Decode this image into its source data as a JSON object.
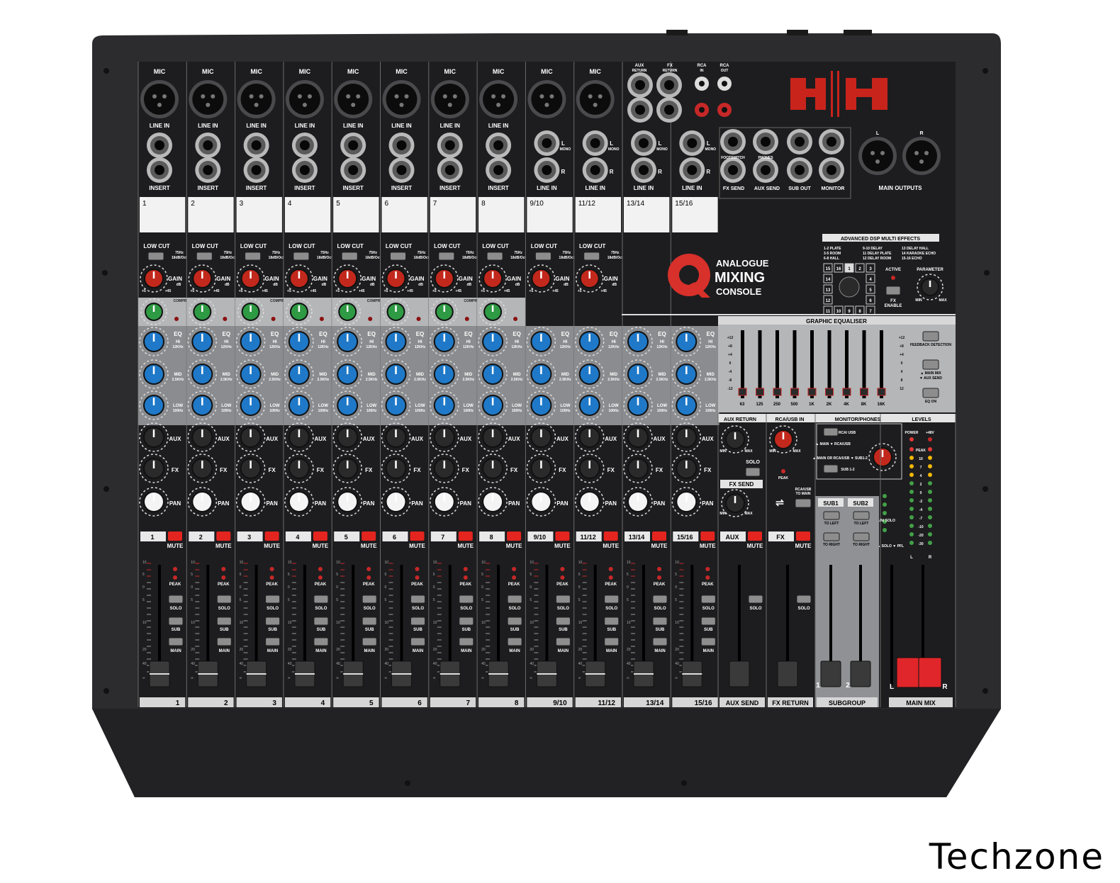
{
  "brand": {
    "logo": "H|H",
    "model_line1": "ANALOGUE",
    "model_line2": "MIXING",
    "model_line3": "CONSOLE"
  },
  "watermark": "Techzone",
  "colors": {
    "chassis": "#2c2c2e",
    "panel_dark": "#1d1d1f",
    "panel_grey": "#b4b6b8",
    "eq_band": "#8a8c8f",
    "label_white": "#f2f2f2",
    "mute_red": "#e4251f",
    "eq_knob": "#1f79c8",
    "comp_knob": "#2e9a43",
    "gain_knob": "#c2281c",
    "main_fader": "#e0262a"
  },
  "channels": [
    {
      "strip": "1",
      "scribble": "1",
      "bottom": "1",
      "type": "mono"
    },
    {
      "strip": "2",
      "scribble": "2",
      "bottom": "2",
      "type": "mono"
    },
    {
      "strip": "3",
      "scribble": "3",
      "bottom": "3",
      "type": "mono"
    },
    {
      "strip": "4",
      "scribble": "4",
      "bottom": "4",
      "type": "mono"
    },
    {
      "strip": "5",
      "scribble": "5",
      "bottom": "5",
      "type": "mono"
    },
    {
      "strip": "6",
      "scribble": "6",
      "bottom": "6",
      "type": "mono"
    },
    {
      "strip": "7",
      "scribble": "7",
      "bottom": "7",
      "type": "mono"
    },
    {
      "strip": "8",
      "scribble": "8",
      "bottom": "8",
      "type": "mono"
    },
    {
      "strip": "9/10",
      "scribble": "9/10",
      "bottom": "9/10",
      "type": "stereo_mic"
    },
    {
      "strip": "11/12",
      "scribble": "11/12",
      "bottom": "11/12",
      "type": "stereo_mic"
    },
    {
      "strip": "13/14",
      "scribble": "13/14",
      "bottom": "13/14",
      "type": "stereo"
    },
    {
      "strip": "15/16",
      "scribble": "15/16",
      "bottom": "15/16",
      "type": "stereo"
    }
  ],
  "labels": {
    "mic": "MIC",
    "line_in": "LINE IN",
    "insert": "INSERT",
    "low_cut": "LOW CUT",
    "low_cut_spec1": "75Hz",
    "low_cut_spec2": "18dB/Oct",
    "gain": "GAIN",
    "gain_db": "dB",
    "gain_min": "+5",
    "gain_max": "+45",
    "compression": "COMPRESSION",
    "eq": "EQ",
    "hi": "HI",
    "hi_freq": "12KHz",
    "mid": "MID",
    "mid_freq": "2.5KHz",
    "low": "LOW",
    "low_freq": "100Hz",
    "aux": "AUX",
    "fx": "FX",
    "pan": "PAN",
    "mute": "MUTE",
    "peak": "PEAK",
    "solo": "SOLO",
    "sub": "SUB",
    "main": "MAIN",
    "mono": "MONO",
    "l": "L",
    "r": "R"
  },
  "inputs_right": {
    "aux_return": "AUX",
    "aux_return2": "RETURN",
    "fx_return": "FX",
    "fx_return2": "RETURN",
    "rca_in": "RCA",
    "rca_in2": "IN",
    "rca_out": "RCA",
    "rca_out2": "OUT",
    "footswitch": "FOOTSWITCH",
    "phones": "PHONES",
    "fx_send": "FX SEND",
    "aux_send": "AUX SEND",
    "sub_out": "SUB OUT",
    "monitor": "MONITOR",
    "main_outputs": "MAIN OUTPUTS"
  },
  "dsp": {
    "title": "ADVANCED DSP MULTI EFFECTS",
    "presets": [
      "1-2 PLATE",
      "3-5 ROOM",
      "6-8 HALL",
      "9-10 DELAY",
      "11 DELAY PLATE",
      "12 DELAY ROOM",
      "13 DELAY HALL",
      "14 KARAOKE ECHO",
      "15-16 ECHO"
    ],
    "active": "ACTIVE",
    "fx_enable1": "FX",
    "fx_enable2": "ENABLE",
    "parameter": "PARAMETER",
    "min": "MIN",
    "max": "MAX",
    "selector": [
      "15",
      "16",
      "1",
      "2",
      "3",
      "14",
      "4",
      "13",
      "5",
      "12",
      "6",
      "11",
      "10",
      "9",
      "8",
      "7"
    ]
  },
  "graphic_eq": {
    "title": "GRAPHIC EQUALISER",
    "bands": [
      "63",
      "125",
      "250",
      "500",
      "1K",
      "2K",
      "4K",
      "8K",
      "16K"
    ],
    "scale": [
      "+12",
      "+8",
      "+4",
      "0",
      "-4",
      "-8",
      "-12"
    ],
    "scale_right": [
      "+12",
      "+8",
      "+4",
      "0",
      "4",
      "8",
      "12"
    ],
    "feedback": "FEEDBACK DETECTION",
    "main_mix": "▲ MAIN MIX",
    "aux_send": "▼ AUX SEND",
    "eq_on": "EQ ON"
  },
  "master_section": {
    "aux_return": "AUX RETURN",
    "rca_usb_in": "RCA/USB IN",
    "monitor_phones": "MONITOR/PHONES",
    "levels": "LEVELS",
    "solo": "SOLO",
    "fx_send": "FX SEND",
    "peak": "PEAK",
    "rca_usb_to_main1": "RCA/USB",
    "rca_usb_to_main2": "TO MAIN",
    "rca_usb": "RCA/ USB",
    "main_rca_usb": "▲ MAIN ▼ RCA/USB",
    "main_or_rca": "▲ MAIN OR RCA/USB ▼ SUB1-2",
    "sub_1_2": "SUB 1-2",
    "power": "POWER",
    "plus48": "+48V",
    "meter": [
      "PEAK",
      "10",
      "7",
      "4",
      "2",
      "0",
      "-2",
      "-4",
      "-7",
      "-10",
      "-20",
      "-30"
    ],
    "sub1": "SUB1",
    "sub2": "SUB2",
    "to_left": "TO LEFT",
    "to_right": "TO RIGHT",
    "main_solo": "MAIN/ SOLO",
    "mode": "MODE ▲ SOLO ▼ PFL",
    "aux_strip": "AUX",
    "fx_strip": "FX",
    "aux_send_bottom": "AUX SEND",
    "fx_return_bottom": "FX RETURN",
    "subgroup_bottom": "SUBGROUP",
    "main_mix_bottom": "MAIN MIX",
    "sub_num1": "1",
    "sub_num2": "2",
    "main_l": "L",
    "main_r": "R"
  },
  "fader_scale": [
    "10",
    "5",
    "0",
    "5",
    "10",
    "20",
    "40",
    "∞"
  ]
}
